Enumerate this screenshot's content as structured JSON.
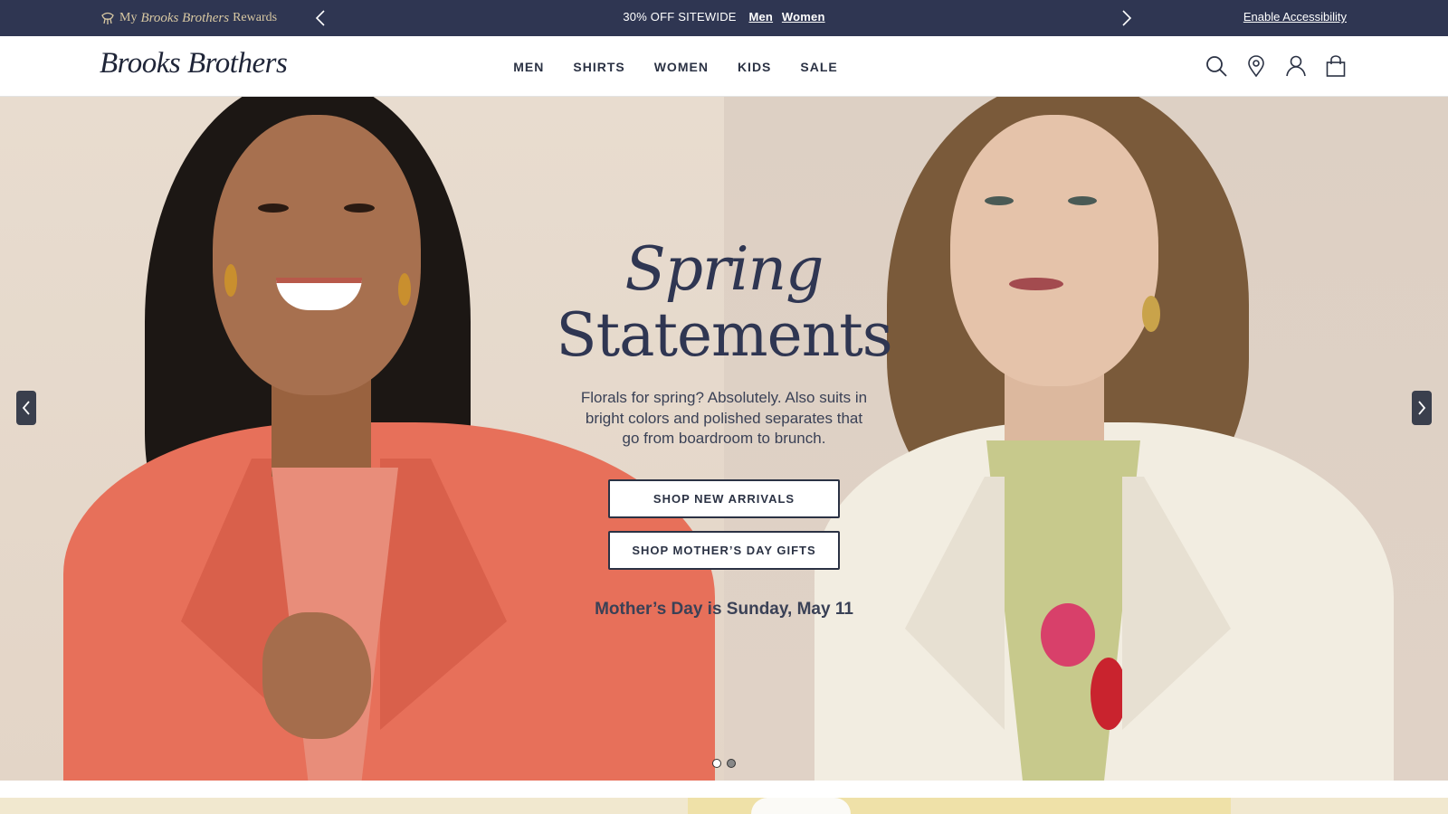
{
  "promo": {
    "rewards_prefix": "My",
    "rewards_script": "Brooks Brothers",
    "rewards_suffix": "Rewards",
    "message": "30% OFF SITEWIDE",
    "link_men": "Men",
    "link_women": "Women",
    "accessibility": "Enable Accessibility"
  },
  "header": {
    "logo": "Brooks Brothers",
    "nav": [
      "MEN",
      "SHIRTS",
      "WOMEN",
      "KIDS",
      "SALE"
    ],
    "icons": [
      "search-icon",
      "location-pin-icon",
      "account-icon",
      "shopping-bag-icon"
    ]
  },
  "hero": {
    "title_line1": "Spring",
    "title_line2": "Statements",
    "description": "Florals for spring? Absolutely. Also suits in bright colors and polished separates that go from boardroom to brunch.",
    "cta_primary": "SHOP NEW ARRIVALS",
    "cta_secondary": "SHOP MOTHER’S DAY GIFTS",
    "note": "Mother’s Day is Sunday, May 11",
    "slides_total": 2,
    "active_slide": 1
  },
  "colors": {
    "promo_bg": "#2f3652",
    "text_navy": "#2f3652",
    "rewards_gold": "#d9c9a3",
    "hero_bg": "#e7dbcf"
  }
}
